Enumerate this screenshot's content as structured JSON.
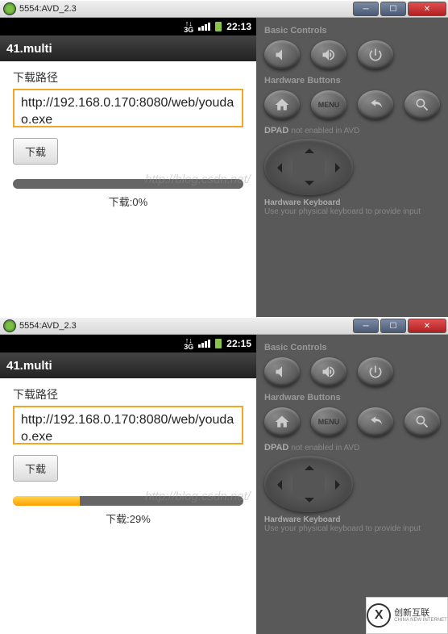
{
  "watermark": "http://blog.csdn.net/",
  "corner_logo": {
    "brand": "创新互联",
    "sub": "CHINA NEW INTERNET"
  },
  "emulators": [
    {
      "window_title": "5554:AVD_2.3",
      "status_time": "22:13",
      "status_net": "3G",
      "app_title": "41.multi",
      "download_label": "下载路径",
      "url": "http://192.168.0.170:8080/web/youdao.exe",
      "button_label": "下载",
      "progress_pct": 0,
      "progress_text": "下载:0%",
      "side": {
        "basic_label": "Basic Controls",
        "hardware_label": "Hardware Buttons",
        "menu_label": "MENU",
        "dpad_label": "DPAD",
        "dpad_note": "not enabled in AVD",
        "hk_label": "Hardware Keyboard",
        "hk_note": "Use your physical keyboard to provide input"
      }
    },
    {
      "window_title": "5554:AVD_2.3",
      "status_time": "22:15",
      "status_net": "3G",
      "app_title": "41.multi",
      "download_label": "下载路径",
      "url": "http://192.168.0.170:8080/web/youdao.exe",
      "button_label": "下载",
      "progress_pct": 29,
      "progress_text": "下载:29%",
      "side": {
        "basic_label": "Basic Controls",
        "hardware_label": "Hardware Buttons",
        "menu_label": "MENU",
        "dpad_label": "DPAD",
        "dpad_note": "not enabled in AVD",
        "hk_label": "Hardware Keyboard",
        "hk_note": "Use your physical keyboard to provide input"
      }
    }
  ]
}
